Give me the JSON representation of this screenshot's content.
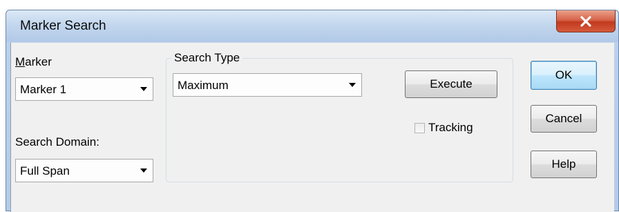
{
  "window": {
    "title": "Marker Search"
  },
  "marker": {
    "label_accel": "M",
    "label_rest": "arker",
    "selected": "Marker 1"
  },
  "search_domain": {
    "label": "Search Domain:",
    "selected": "Full Span"
  },
  "search_type": {
    "group_label": "Search Type",
    "selected": "Maximum"
  },
  "buttons": {
    "execute": "Execute",
    "ok": "OK",
    "cancel": "Cancel",
    "help": "Help"
  },
  "tracking": {
    "label": "Tracking",
    "checked": false
  },
  "icons": {
    "close": "close-icon",
    "dropdown": "chevron-down-icon"
  },
  "colors": {
    "close_button": "#c23a1e",
    "default_button_border": "#3c7fb1",
    "dialog_face": "#f0f0f0"
  }
}
